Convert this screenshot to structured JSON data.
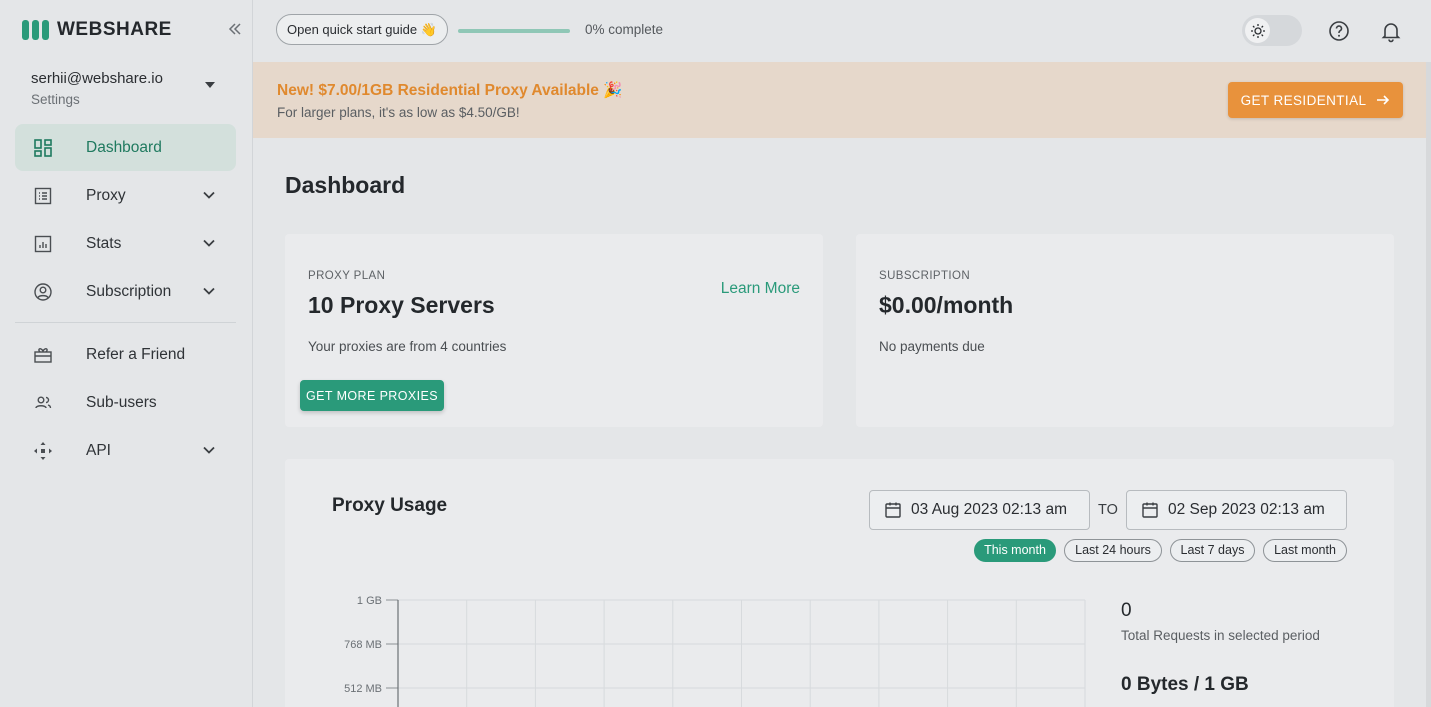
{
  "brand": {
    "name": "WEBSHARE",
    "accent": "#2a9a7a"
  },
  "account": {
    "email": "serhii@webshare.io",
    "subtitle": "Settings"
  },
  "nav": {
    "items": [
      {
        "label": "Dashboard",
        "icon": "dashboard-icon",
        "active": true,
        "expandable": false
      },
      {
        "label": "Proxy",
        "icon": "list-icon",
        "expandable": true
      },
      {
        "label": "Stats",
        "icon": "bar-chart-icon",
        "expandable": true
      },
      {
        "label": "Subscription",
        "icon": "user-circle-icon",
        "expandable": true
      }
    ],
    "secondary": [
      {
        "label": "Refer a Friend",
        "icon": "gift-icon",
        "expandable": false
      },
      {
        "label": "Sub-users",
        "icon": "users-icon",
        "expandable": false
      },
      {
        "label": "API",
        "icon": "api-icon",
        "expandable": true
      }
    ]
  },
  "topbar": {
    "quick_start_label": "Open quick start guide 👋",
    "progress_fraction": 0,
    "progress_text": "0% complete",
    "theme_icon": "sun-icon",
    "help_icon": "help-circle-icon",
    "notifications_icon": "bell-icon"
  },
  "banner": {
    "title": "New! $7.00/1GB Residential Proxy Available 🎉",
    "subtitle": "For larger plans, it's as low as $4.50/GB!",
    "button_label": "GET RESIDENTIAL",
    "color": "#e8923c"
  },
  "main": {
    "title": "Dashboard",
    "proxy_plan": {
      "label": "PROXY PLAN",
      "value": "10 Proxy Servers",
      "description": "Your proxies are from 4 countries",
      "learn_more": "Learn More",
      "button_label": "GET MORE PROXIES"
    },
    "subscription": {
      "label": "SUBSCRIPTION",
      "value": "$0.00/month",
      "description": "No payments due"
    },
    "usage": {
      "title": "Proxy Usage",
      "date_from": "03 Aug 2023 02:13 am",
      "to_label": "TO",
      "date_to": "02 Sep 2023 02:13 am",
      "ranges": [
        "This month",
        "Last 24 hours",
        "Last 7 days",
        "Last month"
      ],
      "active_range": 0,
      "stats": {
        "total_requests_value": "0",
        "total_requests_label": "Total Requests in selected period",
        "bandwidth_value": "0 Bytes / 1 GB"
      }
    }
  },
  "chart_data": {
    "type": "line",
    "y_tick_labels": [
      "1 GB",
      "768 MB",
      "512 MB"
    ],
    "series": [],
    "grid": true
  }
}
